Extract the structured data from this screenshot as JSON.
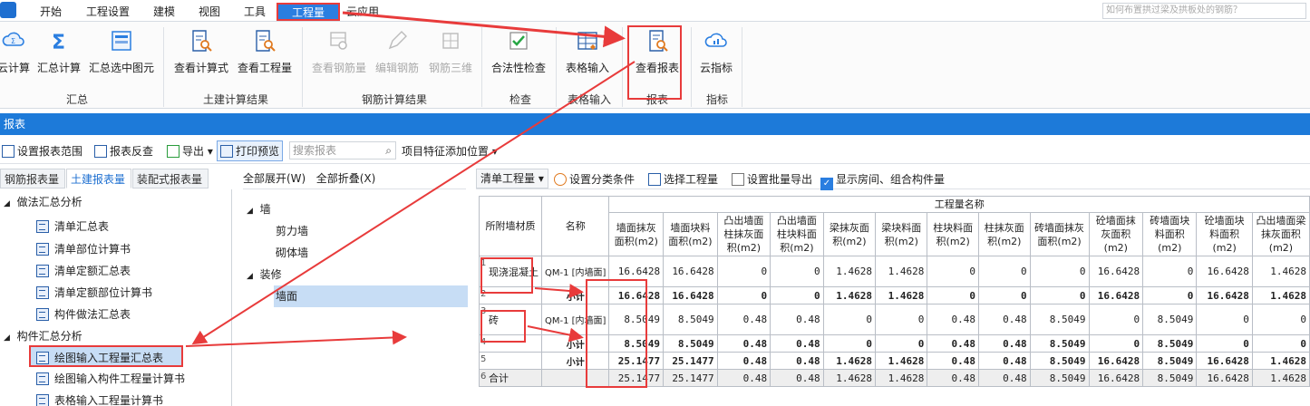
{
  "menu": {
    "items": [
      "开始",
      "工程设置",
      "建模",
      "视图",
      "工具",
      "工程量",
      "云应用"
    ],
    "active": "工程量",
    "search_placeholder": "如何布置拱过梁及拱板处的钢筋？"
  },
  "ribbon": {
    "buttons": {
      "yun_calc": "云计算",
      "sum_calc": "汇总计算",
      "sum_selected": "汇总选中图元",
      "view_formula": "查看计算式",
      "view_quantity": "查看工程量",
      "view_rebar": "查看钢筋量",
      "edit_rebar": "编辑钢筋",
      "rebar_3d": "钢筋三维",
      "legality_check": "合法性检查",
      "table_input": "表格输入",
      "view_report": "查看报表",
      "cloud_index": "云指标"
    },
    "groups": {
      "summary": "汇总",
      "civil_result": "土建计算结果",
      "rebar_result": "钢筋计算结果",
      "check": "检查",
      "table_input": "表格输入",
      "report": "报表",
      "index": "指标"
    }
  },
  "strip_title": "报表",
  "toolbar": {
    "set_range": "设置报表范围",
    "report_check": "报表反查",
    "export": "导出",
    "print_preview": "打印预览",
    "search_placeholder": "搜索报表",
    "feature_pos": "项目特征添加位置"
  },
  "left_tabs": [
    "钢筋报表量",
    "土建报表量",
    "装配式报表量"
  ],
  "tree": {
    "g1": "做法汇总分析",
    "g1_items": [
      "清单汇总表",
      "清单部位计算书",
      "清单定额汇总表",
      "清单定额部位计算书",
      "构件做法汇总表"
    ],
    "g2": "构件汇总分析",
    "g2_items": [
      "绘图输入工程量汇总表",
      "绘图输入构件工程量计算书",
      "表格输入工程量计算书"
    ]
  },
  "middle": {
    "expand_all": "全部展开(W)",
    "collapse_all": "全部折叠(X)",
    "wall": "墙",
    "shear_wall": "剪力墙",
    "masonry_wall": "砌体墙",
    "decor": "装修",
    "wall_face": "墙面"
  },
  "right_toolbar": {
    "dropdown": "清单工程量",
    "set_category": "设置分类条件",
    "select_quantity": "选择工程量",
    "batch_export": "设置批量导出",
    "show_rooms": "显示房间、组合构件量"
  },
  "table": {
    "group_header": "工程量名称",
    "col_material": "所附墙材质",
    "col_name": "名称",
    "quantity_headers": [
      "墙面抹灰面积(m2)",
      "墙面块料面积(m2)",
      "凸出墙面柱抹灰面积(m2)",
      "凸出墙面柱块料面积(m2)",
      "梁抹灰面积(m2)",
      "梁块料面积(m2)",
      "柱块料面积(m2)",
      "柱抹灰面积(m2)",
      "砖墙面抹灰面积(m2)",
      "砼墙面抹灰面积(m2)",
      "砖墙面块料面积(m2)",
      "砼墙面块料面积(m2)",
      "凸出墙面梁抹灰面积(m2)"
    ],
    "rows": [
      {
        "no": "1",
        "material": "现浇混凝土",
        "name": "QM-1 [内墙面]",
        "values": [
          "16.6428",
          "16.6428",
          "0",
          "0",
          "1.4628",
          "1.4628",
          "0",
          "0",
          "0",
          "16.6428",
          "0",
          "16.6428",
          "1.4628"
        ],
        "bold": false
      },
      {
        "no": "2",
        "material": "",
        "name": "小计",
        "values": [
          "16.6428",
          "16.6428",
          "0",
          "0",
          "1.4628",
          "1.4628",
          "0",
          "0",
          "0",
          "16.6428",
          "0",
          "16.6428",
          "1.4628"
        ],
        "bold": true
      },
      {
        "no": "3",
        "material": "砖",
        "name": "QM-1 [内墙面]",
        "values": [
          "8.5049",
          "8.5049",
          "0.48",
          "0.48",
          "0",
          "0",
          "0.48",
          "0.48",
          "8.5049",
          "0",
          "8.5049",
          "0",
          "0"
        ],
        "bold": false
      },
      {
        "no": "4",
        "material": "",
        "name": "小计",
        "values": [
          "8.5049",
          "8.5049",
          "0.48",
          "0.48",
          "0",
          "0",
          "0.48",
          "0.48",
          "8.5049",
          "0",
          "8.5049",
          "0",
          "0"
        ],
        "bold": true
      },
      {
        "no": "5",
        "material": "",
        "name": "小计",
        "values": [
          "25.1477",
          "25.1477",
          "0.48",
          "0.48",
          "1.4628",
          "1.4628",
          "0.48",
          "0.48",
          "8.5049",
          "16.6428",
          "8.5049",
          "16.6428",
          "1.4628"
        ],
        "bold": true
      },
      {
        "no": "6",
        "material": "合计",
        "name": "",
        "values": [
          "25.1477",
          "25.1477",
          "0.48",
          "0.48",
          "1.4628",
          "1.4628",
          "0.48",
          "0.48",
          "8.5049",
          "16.6428",
          "8.5049",
          "16.6428",
          "1.4628"
        ],
        "bold": false
      }
    ]
  }
}
